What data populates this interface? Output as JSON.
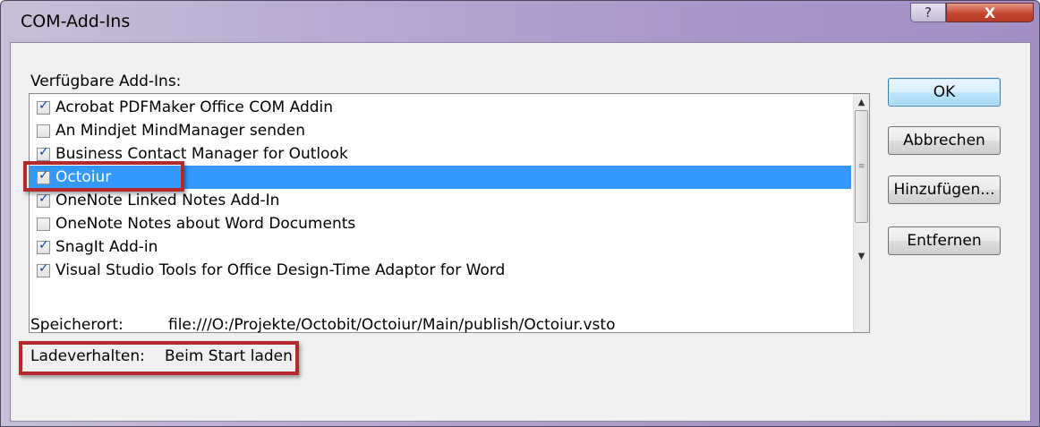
{
  "window": {
    "title": "COM-Add-Ins",
    "help_label": "?",
    "close_label": "X"
  },
  "available_label": "Verfügbare Add-Ins:",
  "addins": [
    {
      "label": "Acrobat PDFMaker Office COM Addin",
      "checked": true,
      "selected": false
    },
    {
      "label": "An Mindjet MindManager senden",
      "checked": false,
      "selected": false
    },
    {
      "label": "Business Contact Manager for Outlook",
      "checked": true,
      "selected": false
    },
    {
      "label": "Octoiur",
      "checked": true,
      "selected": true
    },
    {
      "label": "OneNote Linked Notes Add-In",
      "checked": true,
      "selected": false
    },
    {
      "label": "OneNote Notes about Word Documents",
      "checked": false,
      "selected": false
    },
    {
      "label": "SnagIt Add-in",
      "checked": true,
      "selected": false
    },
    {
      "label": "Visual Studio Tools for Office Design-Time Adaptor for Word",
      "checked": true,
      "selected": false
    }
  ],
  "buttons": {
    "ok": "OK",
    "cancel": "Abbrechen",
    "add": "Hinzufügen...",
    "remove": "Entfernen"
  },
  "location": {
    "label": "Speicherort:",
    "value": "file:///O:/Projekte/Octobit/Octoiur/Main/publish/Octoiur.vsto"
  },
  "load_behavior": {
    "label": "Ladeverhalten:",
    "value": "Beim Start laden"
  },
  "colors": {
    "selection": "#3399ff",
    "highlight_border": "#b22a2a",
    "close_button": "#c5472f"
  },
  "icons": {
    "scroll_up": "▲",
    "scroll_down": "▼",
    "thumb_grip": "≡"
  }
}
